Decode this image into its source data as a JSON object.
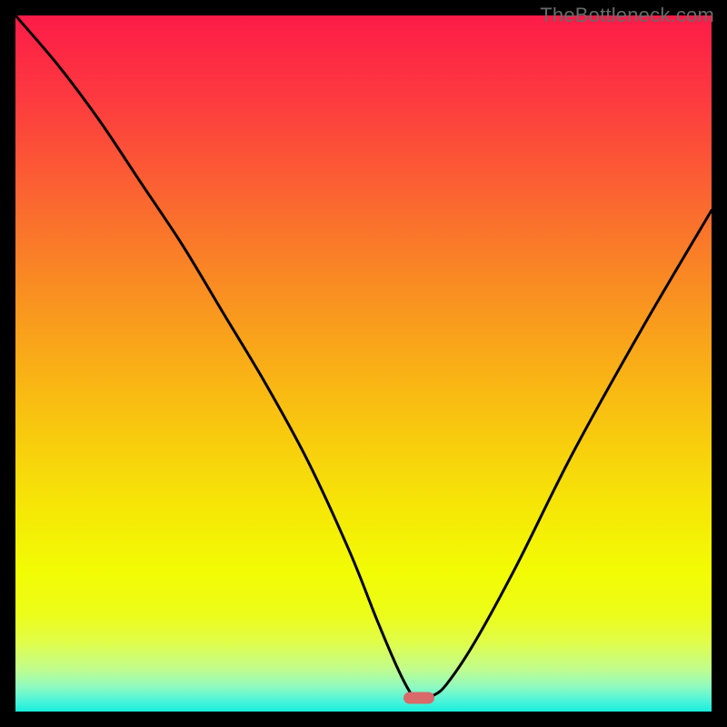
{
  "watermark": "TheBottleneck.com",
  "colors": {
    "background": "#000000",
    "curve": "#000000",
    "marker": "#d86a6a",
    "gradient_stops": [
      {
        "pos": 0.0,
        "color": "#fd1b48"
      },
      {
        "pos": 0.12,
        "color": "#fd3a3f"
      },
      {
        "pos": 0.25,
        "color": "#fb6232"
      },
      {
        "pos": 0.4,
        "color": "#f99021"
      },
      {
        "pos": 0.55,
        "color": "#f9bc12"
      },
      {
        "pos": 0.7,
        "color": "#f6e507"
      },
      {
        "pos": 0.8,
        "color": "#f2fc04"
      },
      {
        "pos": 0.86,
        "color": "#ecfd19"
      },
      {
        "pos": 0.9,
        "color": "#e1fd49"
      },
      {
        "pos": 0.94,
        "color": "#c0fd8f"
      },
      {
        "pos": 0.965,
        "color": "#8dfac1"
      },
      {
        "pos": 0.985,
        "color": "#4bf4da"
      },
      {
        "pos": 1.0,
        "color": "#19eddc"
      }
    ]
  },
  "chart_data": {
    "type": "line",
    "title": "",
    "xlabel": "",
    "ylabel": "",
    "xlim": [
      0,
      100
    ],
    "ylim": [
      0,
      100
    ],
    "legend": false,
    "grid": false,
    "marker": {
      "x": 58,
      "y": 2
    },
    "series": [
      {
        "name": "bottleneck-curve",
        "x": [
          0,
          6,
          12,
          18,
          24,
          30,
          36,
          42,
          48,
          52,
          55,
          57,
          58,
          60,
          62,
          66,
          72,
          80,
          90,
          100
        ],
        "y": [
          100,
          93,
          85,
          76,
          67,
          57,
          47,
          36,
          23,
          13,
          6,
          2.3,
          1.8,
          2.3,
          4,
          10,
          21,
          37,
          55,
          72
        ]
      }
    ]
  }
}
